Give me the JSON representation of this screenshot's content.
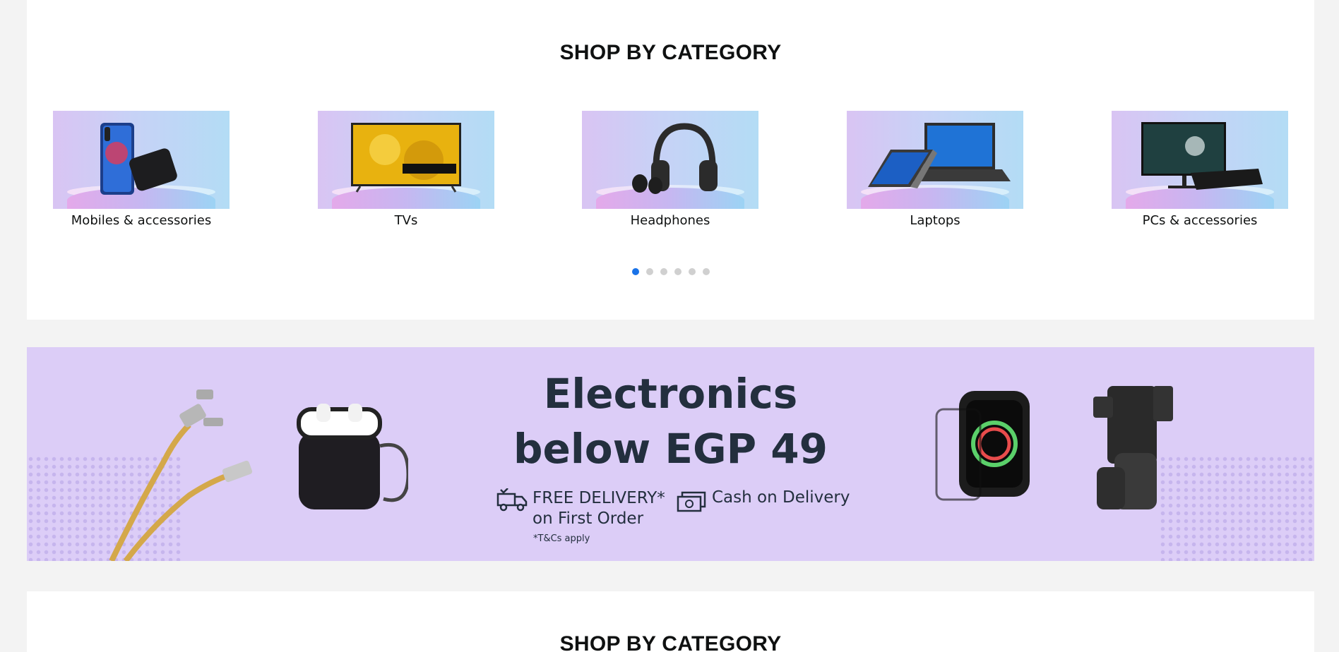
{
  "category_section": {
    "title": "SHOP BY CATEGORY",
    "categories": [
      {
        "label": "Mobiles & accessories",
        "icon": "phone-and-powerbank-icon"
      },
      {
        "label": "TVs",
        "icon": "tv-icon"
      },
      {
        "label": "Headphones",
        "icon": "headphones-icon"
      },
      {
        "label": "Laptops",
        "icon": "laptop-icon"
      },
      {
        "label": "PCs & accessories",
        "icon": "monitor-and-keyboard-icon"
      }
    ],
    "carousel": {
      "page_count": 6,
      "active_index": 0
    }
  },
  "promo_banner": {
    "headline_line1": "Electronics",
    "headline_line2": "below EGP 49",
    "perk_delivery_line1": "FREE DELIVERY*",
    "perk_delivery_line2": "on First Order",
    "perk_cash": "Cash on Delivery",
    "terms": "*T&Cs apply",
    "background_color": "#dccdf7",
    "text_color": "#232f3e"
  },
  "next_section": {
    "title": "SHOP BY CATEGORY"
  },
  "accent_colors": {
    "active_dot": "#1a73e8",
    "inactive_dot": "#d0d0d0"
  }
}
